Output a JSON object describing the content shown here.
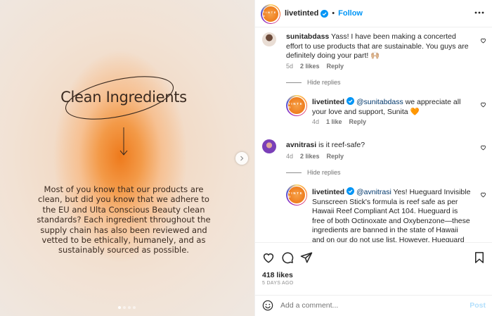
{
  "slide": {
    "title": "Clean Ingredients",
    "body": "Most of you know that our products are clean, but did you know that we adhere to the EU and Ulta Conscious Beauty clean standards?  Each ingredient throughout the supply chain has also been reviewed and vetted to be ethically, humanely, and as sustainably sourced as possible.",
    "dots_total": 4,
    "active_dot": 1
  },
  "header": {
    "avatar_text": "T I N T E D",
    "username": "livetinted",
    "separator": "•",
    "follow_label": "Follow"
  },
  "comments": [
    {
      "username": "sunitabdass",
      "text": "Yass! I have been making a concerted effort to use products that are sustainable. You guys are definitely doing your part! 🙌🏼",
      "age": "5d",
      "likes": "2 likes",
      "reply": "Reply",
      "hide_replies": "Hide replies"
    },
    {
      "username": "livetinted",
      "mention": "@sunitabdass",
      "text": " we appreciate all your love and support, Sunita 🧡",
      "age": "4d",
      "likes": "1 like",
      "reply": "Reply"
    },
    {
      "username": "avnitrasi",
      "text": "is it reef-safe?",
      "age": "4d",
      "likes": "2 likes",
      "reply": "Reply",
      "hide_replies": "Hide replies"
    },
    {
      "username": "livetinted",
      "mention": "@avnitrasi",
      "text": " Yes! Hueguard Invisible Sunscreen Stick's formula is reef safe as per Hawaii Reef Compliant Act 104. Hueguard is free of both Octinoxate and Oxybenzone—these ingredients are banned in the state of Hawaii and on our do not use list. However, Hueguard does contain Zinc Oxide. 🧡"
    }
  ],
  "actions": {
    "likes": "418 likes",
    "time_ago": "5 DAYS AGO"
  },
  "add_comment": {
    "placeholder": "Add a comment...",
    "post_label": "Post"
  },
  "colors": {
    "accent": "#0095f6",
    "brand_orange": "#ef7d1d",
    "mention": "#00376b"
  }
}
